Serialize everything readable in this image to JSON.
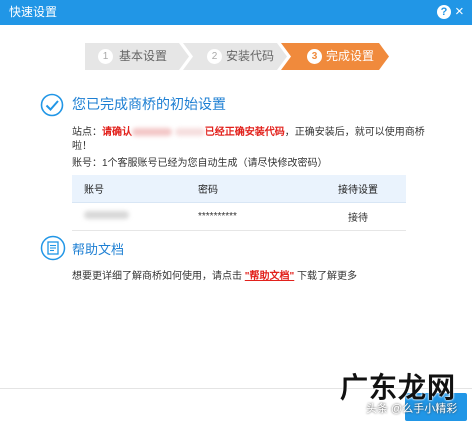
{
  "window": {
    "title": "快速设置",
    "help_label": "?",
    "close_label": "×"
  },
  "steps": [
    {
      "num": "1",
      "label": "基本设置",
      "state": "done"
    },
    {
      "num": "2",
      "label": "安装代码",
      "state": "done"
    },
    {
      "num": "3",
      "label": "完成设置",
      "state": "active"
    }
  ],
  "colors": {
    "accent": "#2196e6",
    "active_step": "#f08a3c",
    "inactive_step": "#e6e6e6",
    "warning_red": "#e2211c",
    "heading_blue": "#1d7fd3"
  },
  "completion": {
    "icon": "check-circle-icon",
    "title": "您已完成商桥的初始设置",
    "site_prefix": "站点：",
    "site_red_1": "请确认",
    "site_red_2": "已经正确安装代码",
    "site_rest": "，正确安装后，就可以使用商桥啦！",
    "account_note": "账号：1个客服账号已经为您自动生成（请尽快修改密码）"
  },
  "account_table": {
    "headers": [
      "账号",
      "密码",
      "接待设置"
    ],
    "rows": [
      {
        "account": "",
        "password": "**********",
        "reception": "接待"
      }
    ]
  },
  "help": {
    "icon": "document-icon",
    "title": "帮助文档",
    "text_before": "想要更详细了解商桥如何使用，请点击",
    "link": "\"帮助文档\"",
    "text_after": "下载了解更多"
  },
  "watermark": {
    "big": "广东龙网",
    "small": "头条 @么手小精彩"
  }
}
